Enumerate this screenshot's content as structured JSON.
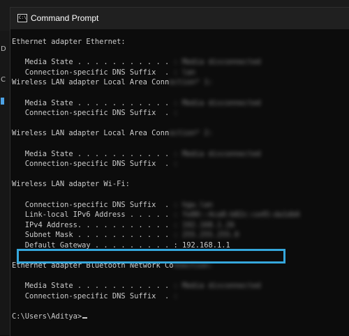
{
  "window": {
    "title": "Command Prompt",
    "icon": "cmd-icon",
    "icon_text": "C:\\"
  },
  "background": {
    "glyph_1": "D",
    "glyph_2": "C"
  },
  "console": {
    "lines": [
      {
        "text": "Ethernet adapter Ethernet:"
      },
      {
        "text": ""
      },
      {
        "text": "   Media State . . . . . . . . . . . ",
        "blur": ": Media disconnected"
      },
      {
        "text": "   Connection-specific DNS Suffix  . ",
        "blur": ": lan"
      },
      {
        "text": "Wireless LAN adapter Local Area Conn",
        "blur": "ection* 1:"
      },
      {
        "text": ""
      },
      {
        "text": "   Media State . . . . . . . . . . . ",
        "blur": ": Media disconnected"
      },
      {
        "text": "   Connection-specific DNS Suffix  . ",
        "blur": ":"
      },
      {
        "text": ""
      },
      {
        "text": "Wireless LAN adapter Local Area Conn",
        "blur": "ection* 2:"
      },
      {
        "text": ""
      },
      {
        "text": "   Media State . . . . . . . . . . . ",
        "blur": ": Media disconnected"
      },
      {
        "text": "   Connection-specific DNS Suffix  . ",
        "blur": ":"
      },
      {
        "text": ""
      },
      {
        "text": "Wireless LAN adapter Wi-Fi:"
      },
      {
        "text": ""
      },
      {
        "text": "   Connection-specific DNS Suffix  . ",
        "blur": ": hgw.lan"
      },
      {
        "text": "   Link-local IPv6 Address . . . . . ",
        "blur": ": fe80::4ca8:b82c:ce45:da1db6"
      },
      {
        "text": "   IPv4 Address. . . . . . . . . . . ",
        "blur": ": 192.168.1.26"
      },
      {
        "text": "   Subnet Mask . . . . . . . . . . . ",
        "blur": ": 255.255.255.0"
      },
      {
        "text": "   Default Gateway . . . . . . . . . : 192.168.1.1"
      },
      {
        "text": ""
      },
      {
        "text": "Ethernet adapter Bluetooth Network Co",
        "blur": "nnection:"
      },
      {
        "text": ""
      },
      {
        "text": "   Media State . . . . . . . . . . . ",
        "blur": ": Media disconnected"
      },
      {
        "text": "   Connection-specific DNS Suffix  . ",
        "blur": ":"
      },
      {
        "text": ""
      },
      {
        "text": "C:\\Users\\Aditya>",
        "cursor": true
      }
    ]
  },
  "highlight": {
    "target": "Default Gateway",
    "color": "#35a7dc"
  }
}
